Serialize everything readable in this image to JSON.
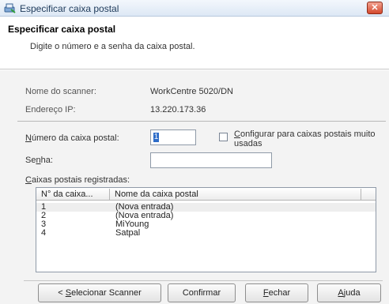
{
  "window": {
    "title": "Especificar caixa postal",
    "close_glyph": "✕"
  },
  "header": {
    "title": "Especificar caixa postal",
    "subtitle": "Digite o número e a senha da caixa postal."
  },
  "info": {
    "scanner_label": "Nome do scanner:",
    "scanner_value": "WorkCentre 5020/DN",
    "ip_label": "Endereço IP:",
    "ip_value": "13.220.173.36"
  },
  "form": {
    "mailbox_label_pre": "",
    "mailbox_label_u": "N",
    "mailbox_label_post": "úmero da caixa postal:",
    "mailbox_value": "1",
    "password_label_pre": "Se",
    "password_label_u": "n",
    "password_label_post": "ha:",
    "password_value": "",
    "checkbox_label_pre": "",
    "checkbox_label_u": "C",
    "checkbox_label_post": "onfigurar para caixas postais muito usadas",
    "checkbox_checked": false
  },
  "list": {
    "label_u": "C",
    "label_post": "aixas postais registradas:",
    "columns": [
      "N° da caixa...",
      "Nome da caixa postal"
    ],
    "rows": [
      {
        "number": "1",
        "name": "(Nova entrada)"
      },
      {
        "number": "2",
        "name": "(Nova entrada)"
      },
      {
        "number": "3",
        "name": "MiYoung"
      },
      {
        "number": "4",
        "name": "Satpal"
      }
    ]
  },
  "buttons": {
    "back_pre": "< ",
    "back_u": "S",
    "back_post": "elecionar Scanner",
    "confirm": "Confirmar",
    "close_u": "F",
    "close_post": "echar",
    "help_u": "A",
    "help_post": "juda"
  },
  "colors": {
    "titlebar": "#dde8f5",
    "close_button": "#d4482c",
    "selection_caret": "#2d6cc8"
  }
}
